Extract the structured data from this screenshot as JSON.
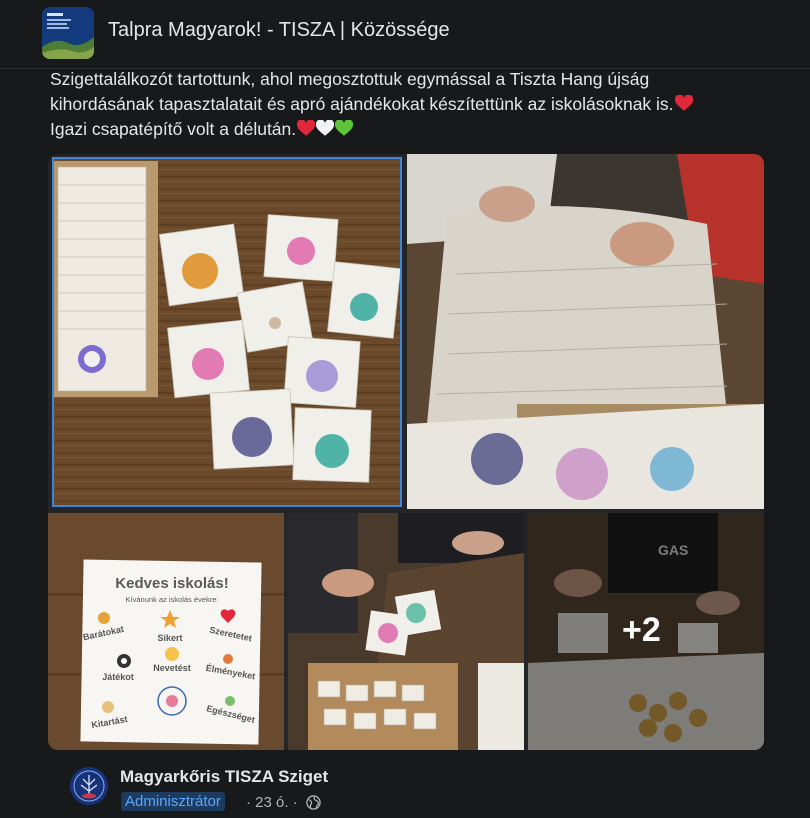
{
  "group": {
    "title": "Talpra Magyarok! - TISZA | Közössége"
  },
  "post": {
    "lines": [
      "Szigettalálkozót tartottunk, ahol megosztottuk egymással a Tiszta Hang újság",
      "kihordásának tapasztalatait és apró ajándékokat készítettünk az iskolásoknak is.",
      "Igazi csapatépítő volt a délután."
    ],
    "emoji": [
      "red-heart",
      "red-heart",
      "white-heart",
      "green-heart"
    ],
    "colors": {
      "red": "#e0283a",
      "white": "#f2f2f2",
      "green": "#5dc43a"
    }
  },
  "photos": {
    "card_heading": "Kedves iskolás!",
    "card_subheading": "Kívánunk az iskolás évekre:",
    "card_wishes": [
      "Barátokat",
      "Sikert",
      "Szeretetet",
      "Nevetést",
      "Játékot",
      "Élményeket",
      "Kitartást",
      "Egészséget"
    ],
    "more_count": "+2",
    "shirt_text": "GAS"
  },
  "author": {
    "name": "Magyarkőris TISZA Sziget",
    "role": "Adminisztrátor",
    "time": "23 ó."
  },
  "icons": {
    "privacy": "globe-icon"
  }
}
